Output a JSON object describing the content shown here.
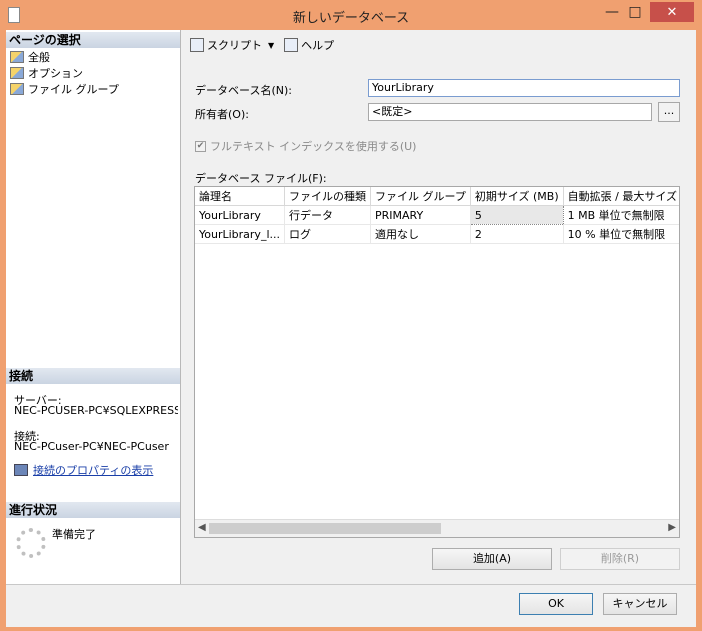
{
  "window": {
    "title": "新しいデータベース",
    "min_glyph": "—",
    "max_glyph": "□",
    "close_glyph": "✕"
  },
  "left_pane": {
    "page_select_header": "ページの選択",
    "pages": [
      {
        "label": "全般",
        "icon": "page-icon"
      },
      {
        "label": "オプション",
        "icon": "page-icon"
      },
      {
        "label": "ファイル グループ",
        "icon": "page-icon"
      }
    ],
    "connection_header": "接続",
    "server_label": "サーバー:",
    "server_value": "NEC-PCUSER-PC¥SQLEXPRESS",
    "connection_label": "接続:",
    "connection_value": "NEC-PCuser-PC¥NEC-PCuser",
    "connection_props_link": "接続のプロパティの表示",
    "progress_header": "進行状況",
    "progress_status": "準備完了"
  },
  "toolbar": {
    "script_label": "スクリプト",
    "help_label": "ヘルプ"
  },
  "form": {
    "db_name_label": "データベース名(N):",
    "db_name_value": "YourLibrary",
    "owner_label": "所有者(O):",
    "owner_value": "<既定>",
    "owner_browse": "...",
    "fulltext_label": "フルテキスト インデックスを使用する(U)",
    "fulltext_checked": true,
    "files_label": "データベース ファイル(F):"
  },
  "files_table": {
    "columns": [
      "論理名",
      "ファイルの種類",
      "ファイル グループ",
      "初期サイズ (MB)",
      "自動拡張 / 最大サイズ"
    ],
    "rows": [
      [
        "YourLibrary",
        "行データ",
        "PRIMARY",
        "5",
        "1 MB 単位で無制限"
      ],
      [
        "YourLibrary_l...",
        "ログ",
        "適用なし",
        "2",
        "10 % 単位で無制限"
      ]
    ]
  },
  "buttons": {
    "add": "追加(A)",
    "remove": "削除(R)",
    "ok": "OK",
    "cancel": "キャンセル"
  }
}
